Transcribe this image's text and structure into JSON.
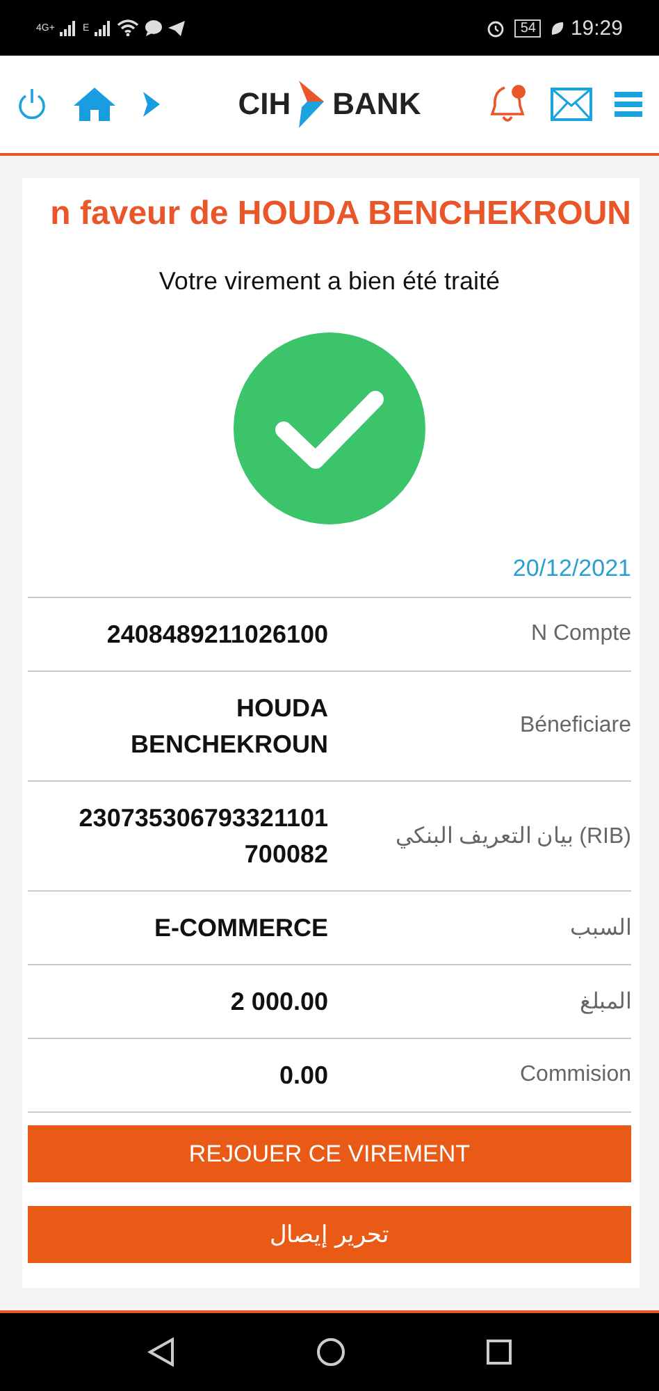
{
  "status_bar": {
    "network_1": "4G+",
    "network_2": "E",
    "battery": "54",
    "time": "19:29"
  },
  "header": {
    "logo_left": "CIH",
    "logo_right": "BANK",
    "notification": true
  },
  "title": "n faveur de HOUDA BENCHEKROUN",
  "message": "Votre virement a bien été traité",
  "date": "20/12/2021",
  "rows": [
    {
      "label": "N Compte",
      "value": [
        "2408489211026100"
      ]
    },
    {
      "label": "Béneficiare",
      "value": [
        "HOUDA",
        "BENCHEKROUN"
      ]
    },
    {
      "label": "بيان التعريف البنكي (RIB)",
      "value": [
        "230735306793321101",
        "700082"
      ]
    },
    {
      "label": "السبب",
      "value": [
        "E-COMMERCE"
      ]
    },
    {
      "label": "المبلغ",
      "value": [
        "2 000.00"
      ]
    },
    {
      "label": "Commision",
      "value": [
        "0.00"
      ]
    }
  ],
  "buttons": [
    "REJOUER CE VIREMENT",
    "تحرير إيصال"
  ]
}
